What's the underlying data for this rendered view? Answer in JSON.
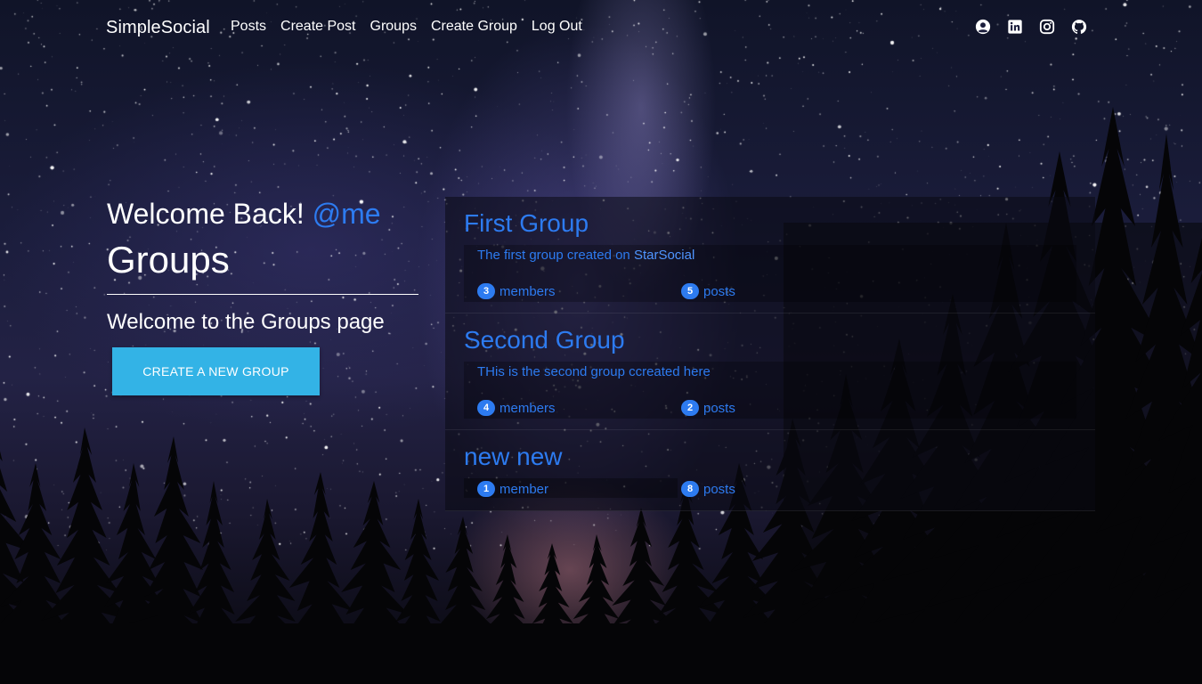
{
  "navbar": {
    "brand": "SimpleSocial",
    "links": [
      {
        "label": "Posts"
      },
      {
        "label": "Create Post"
      },
      {
        "label": "Groups"
      },
      {
        "label": "Create Group"
      },
      {
        "label": "Log Out"
      }
    ],
    "social_icons": [
      "user-circle-icon",
      "linkedin-icon",
      "instagram-icon",
      "github-icon"
    ]
  },
  "welcome": {
    "prefix": "Welcome Back!",
    "username": "@me"
  },
  "page": {
    "title": "Groups",
    "lead": "Welcome to the Groups page",
    "create_button": "CREATE A NEW GROUP"
  },
  "groups": [
    {
      "name": "First Group",
      "description": "The first group created on ",
      "description_link": "StarSocial",
      "members_count": "3",
      "members_label": "members",
      "posts_count": "5",
      "posts_label": "posts"
    },
    {
      "name": "Second Group",
      "description": "THis is the second group ccreated here",
      "description_link": "",
      "members_count": "4",
      "members_label": "members",
      "posts_count": "2",
      "posts_label": "posts"
    },
    {
      "name": "new new",
      "description": "",
      "description_link": "",
      "members_count": "1",
      "members_label": "member",
      "posts_count": "8",
      "posts_label": "posts"
    }
  ],
  "colors": {
    "accent": "#2d7bf0",
    "button": "#33b3e6"
  }
}
